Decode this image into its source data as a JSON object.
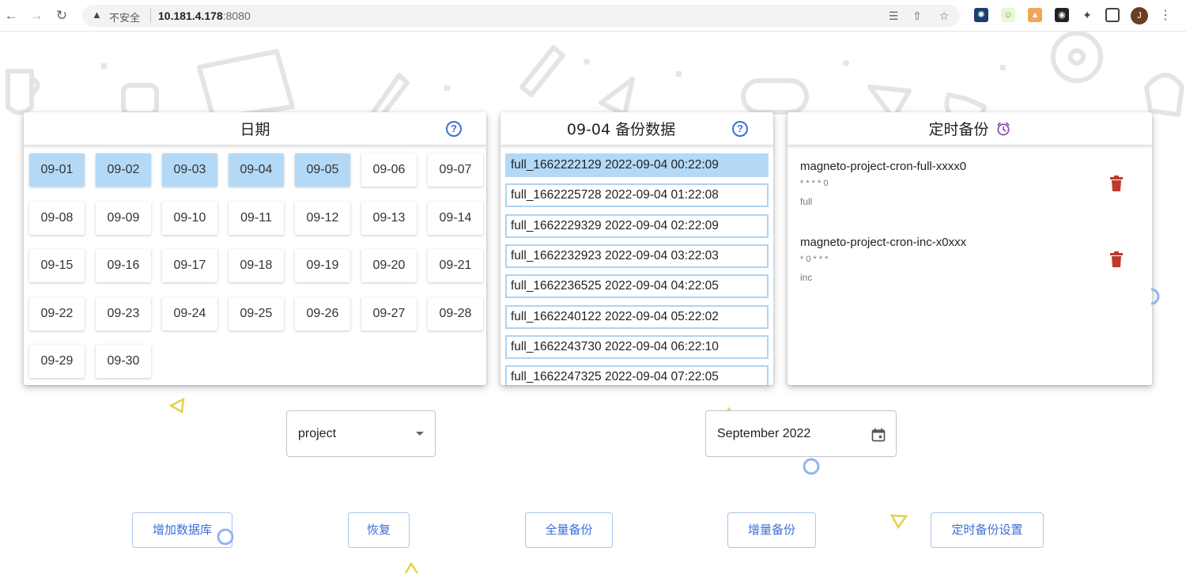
{
  "browser": {
    "back_icon": "arrow-left-icon",
    "forward_icon": "arrow-right-icon",
    "reload_icon": "reload-icon",
    "security_label": "不安全",
    "url_host": "10.181.4.178",
    "url_port": ":8080"
  },
  "dates_card": {
    "title": "日期",
    "dates": [
      "09-01",
      "09-02",
      "09-03",
      "09-04",
      "09-05",
      "09-06",
      "09-07",
      "09-08",
      "09-09",
      "09-10",
      "09-11",
      "09-12",
      "09-13",
      "09-14",
      "09-15",
      "09-16",
      "09-17",
      "09-18",
      "09-19",
      "09-20",
      "09-21",
      "09-22",
      "09-23",
      "09-24",
      "09-25",
      "09-26",
      "09-27",
      "09-28",
      "09-29",
      "09-30"
    ],
    "selected": [
      "09-01",
      "09-02",
      "09-03",
      "09-04",
      "09-05"
    ]
  },
  "backup_card": {
    "title": "09-04 备份数据",
    "items": [
      "full_1662222129 2022-09-04 00:22:09",
      "full_1662225728 2022-09-04 01:22:08",
      "full_1662229329 2022-09-04 02:22:09",
      "full_1662232923 2022-09-04 03:22:03",
      "full_1662236525 2022-09-04 04:22:05",
      "full_1662240122 2022-09-04 05:22:02",
      "full_1662243730 2022-09-04 06:22:10",
      "full_1662247325 2022-09-04 07:22:05"
    ],
    "selected_index": 0
  },
  "cron_card": {
    "title": "定时备份",
    "jobs": [
      {
        "name": "magneto-project-cron-full-xxxx0",
        "expr": "* * * * 0",
        "type": "full"
      },
      {
        "name": "magneto-project-cron-inc-x0xxx",
        "expr": "* 0 * * *",
        "type": "inc"
      }
    ]
  },
  "controls": {
    "project_select_value": "project",
    "month_value": "September 2022"
  },
  "buttons": {
    "add_db": "增加数据库",
    "restore": "恢复",
    "full_backup": "全量备份",
    "inc_backup": "增量备份",
    "cron_settings": "定时备份设置"
  },
  "colors": {
    "accent": "#3b6fd8",
    "selected_bg": "#b3d9f7",
    "delete_red": "#c0392b",
    "alarm_purple": "#8e44ad"
  }
}
